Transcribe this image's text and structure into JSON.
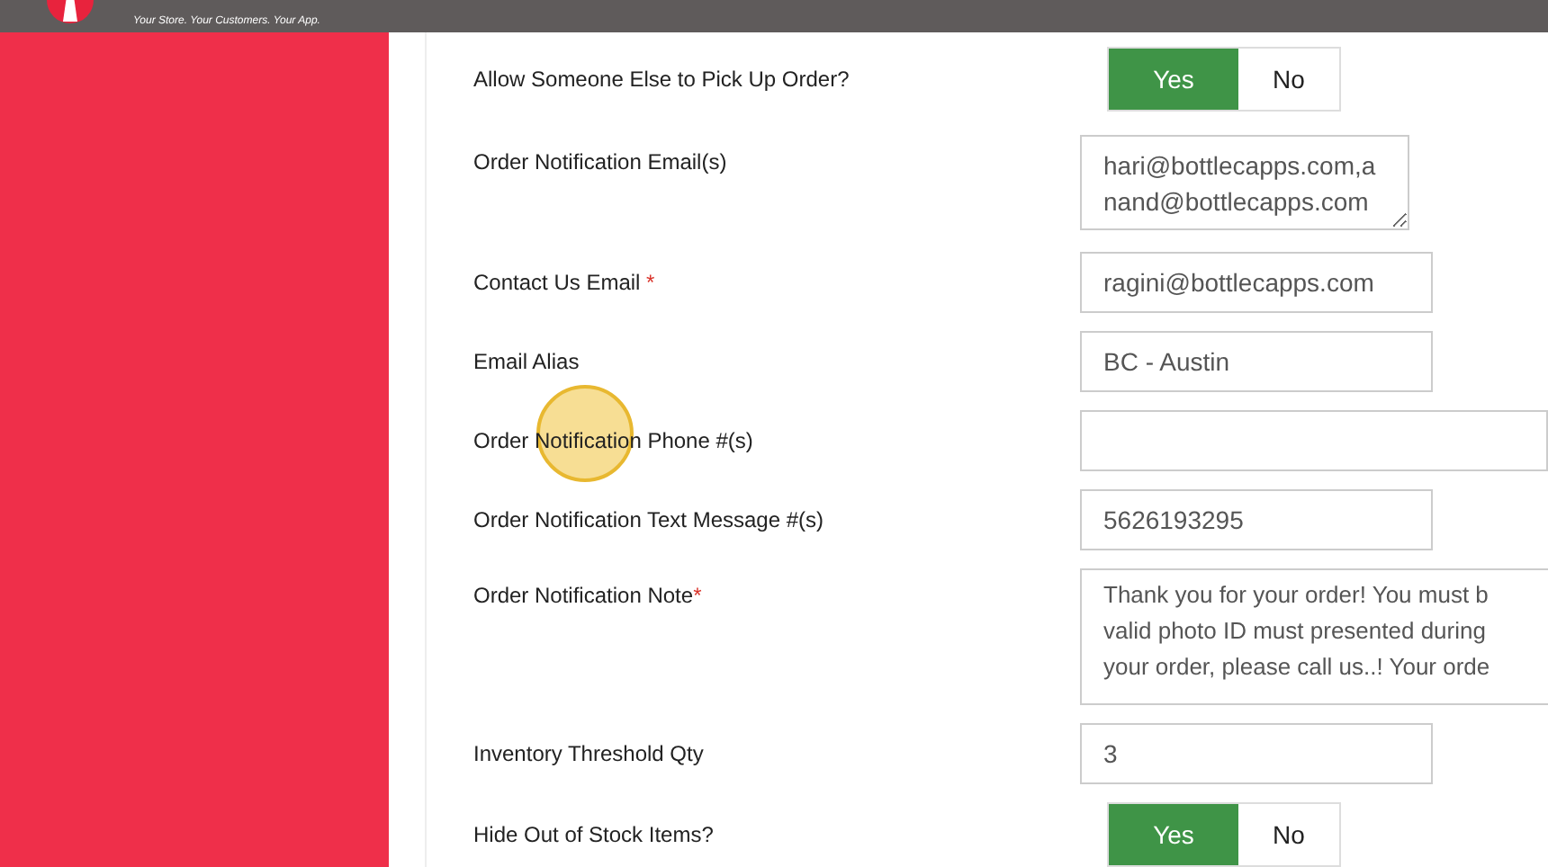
{
  "header": {
    "tagline": "Your Store. Your Customers. Your App."
  },
  "fields": [
    {
      "kind": "toggle",
      "label": "Allow Someone Else to Pick Up Order?",
      "yes": "Yes",
      "no": "No",
      "on": true
    },
    {
      "kind": "textarea",
      "label": "Order Notification Email(s)",
      "value": "hari@bottlecapps.com,anand@bottlecapps.com"
    },
    {
      "kind": "input",
      "label": "Contact Us Email",
      "required_mark": "*",
      "value": "ragini@bottlecapps.com"
    },
    {
      "kind": "input",
      "label": "Email Alias",
      "value": "BC - Austin"
    },
    {
      "kind": "wide",
      "label": "Order Notification Phone #(s)"
    },
    {
      "kind": "input",
      "label": "Order Notification Text Message #(s)",
      "value": "5626193295"
    },
    {
      "kind": "note",
      "label": "Order Notification Note",
      "required_mark": "*",
      "lines": [
        "Thank you for your order! You must b",
        "valid photo ID must presented during",
        "your order, please call us..! Your orde"
      ]
    },
    {
      "kind": "input",
      "label": "Inventory Threshold Qty",
      "value": "3"
    },
    {
      "kind": "toggle",
      "label": "Hide Out of Stock Items?",
      "yes": "Yes",
      "no": "No",
      "on": true
    }
  ]
}
